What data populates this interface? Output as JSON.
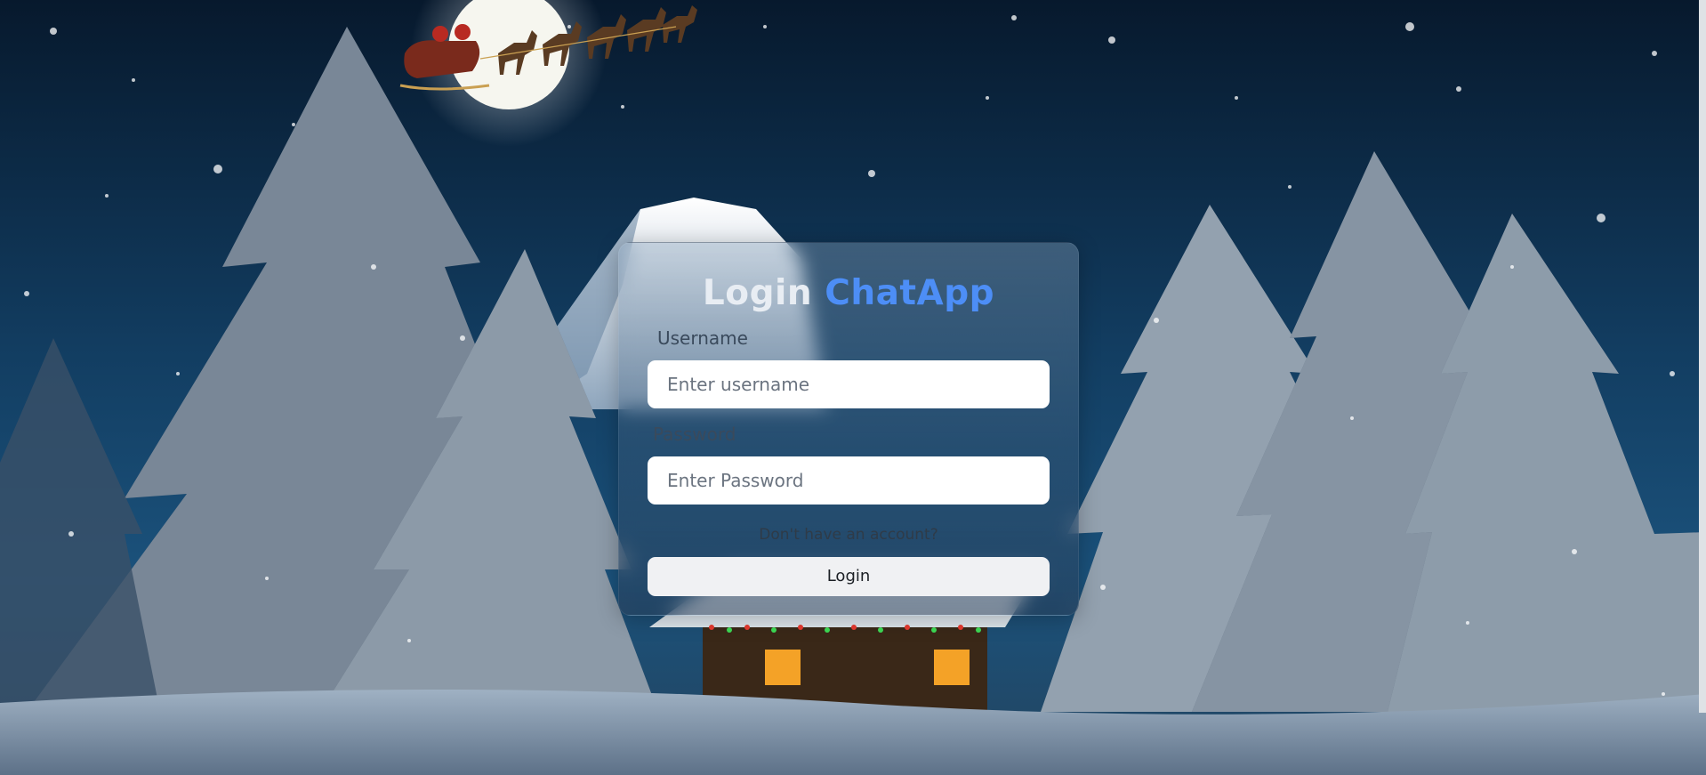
{
  "login": {
    "title_prefix": "Login",
    "title_brand": "ChatApp",
    "username_label": "Username",
    "username_placeholder": "Enter username",
    "password_label": "Password",
    "password_placeholder": "Enter Password",
    "signup_link": "Don't have an account?",
    "submit_label": "Login"
  },
  "colors": {
    "brand": "#4d8ef6",
    "sky_top": "#07192d",
    "sky_mid": "#17507a",
    "snow": "#dfe7ef"
  }
}
